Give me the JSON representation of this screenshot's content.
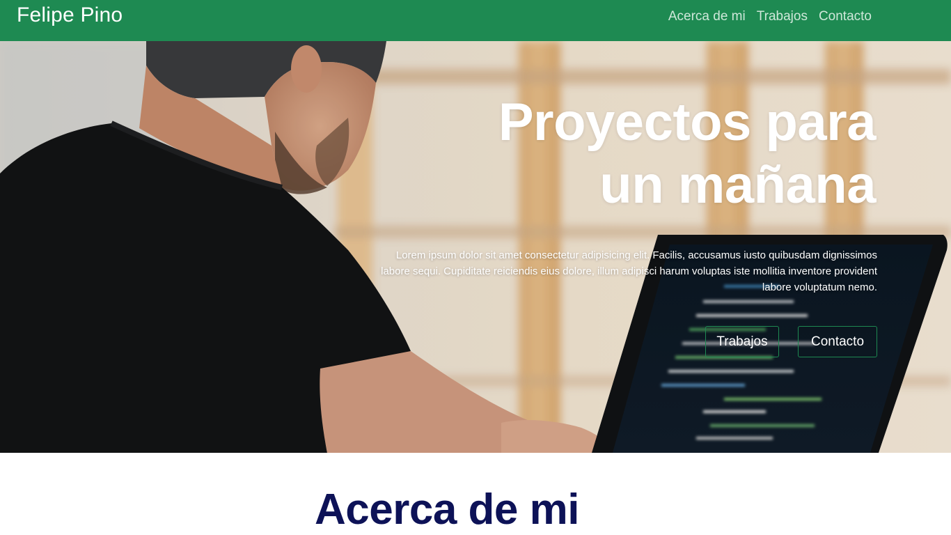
{
  "navbar": {
    "brand": "Felipe Pino",
    "links": [
      {
        "label": "Acerca de mi"
      },
      {
        "label": "Trabajos"
      },
      {
        "label": "Contacto"
      }
    ]
  },
  "hero": {
    "title": "Proyectos para un mañana",
    "text": "Lorem ipsum dolor sit amet consectetur adipisicing elit. Facilis, accusamus iusto quibusdam dignissimos labore sequi. Cupiditate reiciendis eius dolore, illum adipisci harum voluptas iste mollitia inventore provident labore voluptatum nemo.",
    "buttons": [
      {
        "label": "Trabajos"
      },
      {
        "label": "Contacto"
      }
    ]
  },
  "about": {
    "title": "Acerca de mi"
  },
  "colors": {
    "navbar": "#1e8a52",
    "heading_dark": "#0d1257",
    "button_border": "#1e8a52"
  }
}
